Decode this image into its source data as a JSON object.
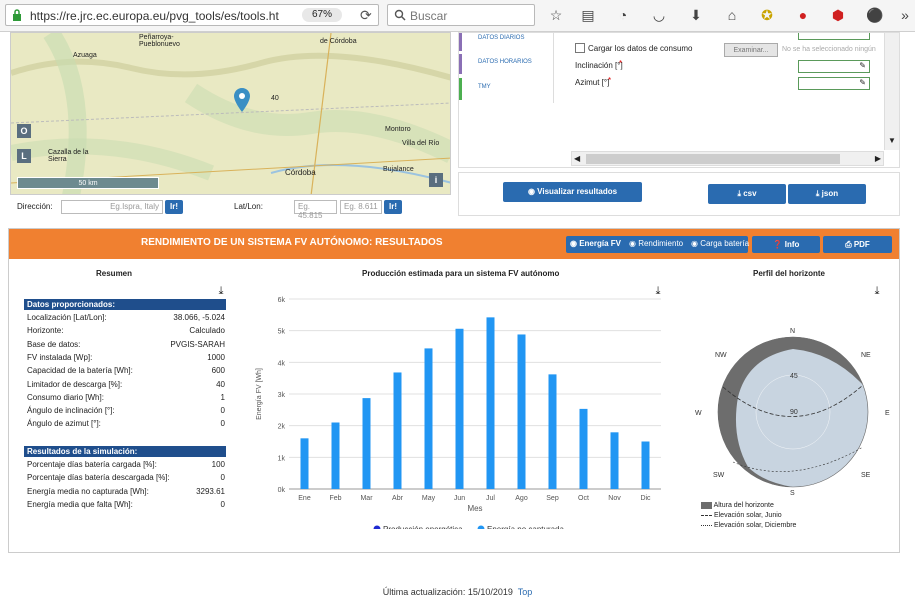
{
  "browser": {
    "url": "https://re.jrc.ec.europa.eu/pvg_tools/es/tools.ht",
    "zoom": "67%",
    "search_placeholder": "Buscar"
  },
  "map": {
    "places": [
      "Peñarroya-Pueblonuevo",
      "Azuaga",
      "de Córdoba",
      "Cazalla de la Sierra",
      "Montoro",
      "Villa del Río",
      "Córdoba",
      "Bujalance"
    ],
    "road_labels": [
      "40"
    ],
    "scale": "50 km",
    "btn_o": "O",
    "btn_l": "L",
    "btn_i": "i"
  },
  "location": {
    "dir_label": "Dirección:",
    "dir_placeholder": "Eg.Ispra, Italy",
    "go1": "Ir!",
    "latlon_label": "Lat/Lon:",
    "lat_placeholder": "Eg. 45.815",
    "lon_placeholder": "Eg. 8.611",
    "go2": "Ir!"
  },
  "sidebar_tabs": [
    "DATOS DIARIOS",
    "DATOS HORARIOS",
    "TMY"
  ],
  "form": {
    "load_consumption": "Cargar los datos de consumo",
    "browse": "Examinar...",
    "no_file": "No se ha seleccionado ningún",
    "inclination": "Inclinación [°]",
    "azimuth": "Azimut [°]",
    "required": "*"
  },
  "actions": {
    "visualize": "Visualizar resultados",
    "csv": "csv",
    "json": "json"
  },
  "results": {
    "title": "RENDIMIENTO DE UN SISTEMA FV AUTÓNOMO: RESULTADOS",
    "tabs": [
      "Energía FV",
      "Rendimiento",
      "Carga batería"
    ],
    "info": "Info",
    "pdf": "PDF",
    "summary_title": "Resumen",
    "chart_title": "Producción estimada para un sistema FV autónomo",
    "horizon_title": "Perfil del horizonte",
    "provided_header": "Datos proporcionados:",
    "provided": [
      {
        "k": "Localización [Lat/Lon]:",
        "v": "38.066, -5.024"
      },
      {
        "k": "Horizonte:",
        "v": "Calculado"
      },
      {
        "k": "Base de datos:",
        "v": "PVGIS-SARAH"
      },
      {
        "k": "FV instalada [Wp]:",
        "v": "1000"
      },
      {
        "k": "Capacidad de la batería [Wh]:",
        "v": "600"
      },
      {
        "k": "Limitador de descarga [%]:",
        "v": "40"
      },
      {
        "k": "Consumo diario [Wh]:",
        "v": "1"
      },
      {
        "k": "Ángulo de inclinación [°]:",
        "v": "0"
      },
      {
        "k": "Ángulo de azimut [°]:",
        "v": "0"
      }
    ],
    "sim_header": "Resultados de la simulación:",
    "sim": [
      {
        "k": "Porcentaje días batería cargada [%]:",
        "v": "100"
      },
      {
        "k": "Porcentaje días batería descargada [%]:",
        "v": "0"
      },
      {
        "k": "Energía media no capturada [Wh]:",
        "v": "3293.61"
      },
      {
        "k": "Energía media que falta [Wh]:",
        "v": "0"
      }
    ]
  },
  "chart_data": {
    "type": "bar",
    "categories": [
      "Ene",
      "Feb",
      "Mar",
      "Abr",
      "May",
      "Jun",
      "Jul",
      "Ago",
      "Sep",
      "Oct",
      "Nov",
      "Dic"
    ],
    "series": [
      {
        "name": "Producción energética",
        "color": "#1f2ad1",
        "values": [
          0,
          0,
          0,
          0,
          0,
          0,
          0,
          0,
          0,
          0,
          0,
          0
        ]
      },
      {
        "name": "Energía no capturada",
        "color": "#2196f3",
        "values": [
          1600,
          2100,
          2870,
          3680,
          4440,
          5060,
          5420,
          4880,
          3620,
          2530,
          1790,
          1500
        ]
      }
    ],
    "xlabel": "Mes",
    "ylabel": "Energía FV [Wh]",
    "ylim": [
      0,
      6000
    ],
    "yticks": [
      "0k",
      "1k",
      "2k",
      "3k",
      "4k",
      "5k",
      "6k"
    ],
    "grid": true,
    "legend": "bottom"
  },
  "horizon": {
    "compass": [
      "N",
      "NE",
      "E",
      "SE",
      "S",
      "SW",
      "W",
      "NW"
    ],
    "rings": [
      "45",
      "90"
    ],
    "legend": [
      "Altura del horizonte",
      "Elevación solar, Junio",
      "Elevación solar, Diciembre"
    ],
    "colors": {
      "horizon": "#6d6d6d",
      "sky": "#c8d4e0"
    }
  },
  "footer": {
    "updated": "Última actualización: 15/10/2019",
    "top": "Top"
  }
}
